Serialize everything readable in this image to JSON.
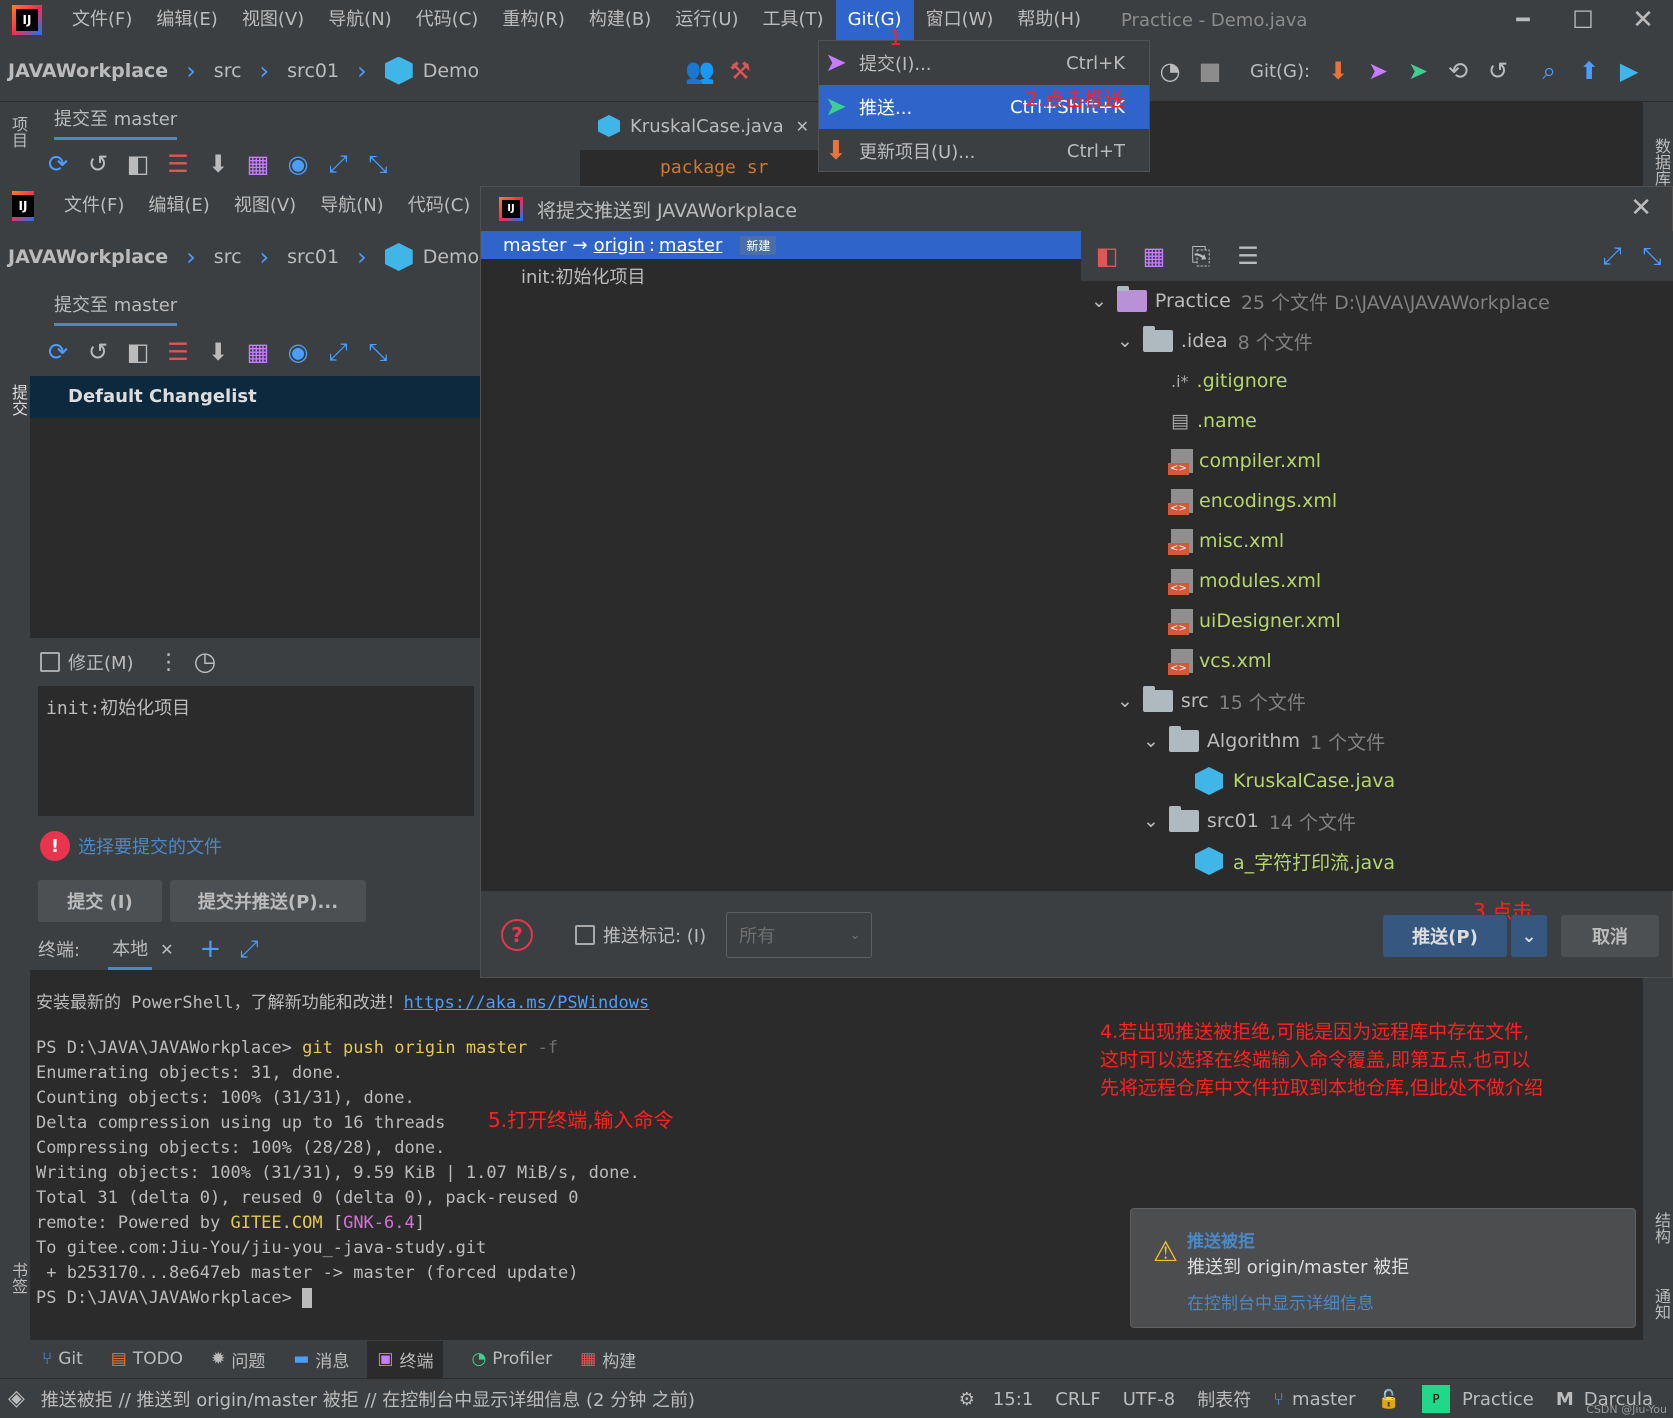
{
  "menubar": {
    "items": [
      "文件(F)",
      "编辑(E)",
      "视图(V)",
      "导航(N)",
      "代码(C)",
      "重构(R)",
      "构建(B)",
      "运行(U)",
      "工具(T)",
      "Git(G)",
      "窗口(W)",
      "帮助(H)"
    ],
    "title": "Practice - Demo.java"
  },
  "navbar": {
    "project": "JAVAWorkplace",
    "crumbs": [
      "src",
      "src01",
      "Demo"
    ],
    "git_label": "Git(G):"
  },
  "git_menu": {
    "items": [
      {
        "label": "提交(I)...",
        "shortcut": "Ctrl+K"
      },
      {
        "label": "推送...",
        "shortcut": "Ctrl+Shift+K"
      },
      {
        "label": "更新项目(U)...",
        "shortcut": "Ctrl+T"
      }
    ]
  },
  "annotations": {
    "a1": "1",
    "a2": "2.点击推送",
    "a3": "3.点击",
    "a4": [
      "4.若出现推送被拒绝,可能是因为远程库中存在文件,",
      "这时可以选择在终端输入命令覆盖,即第五点,也可以",
      "先将远程仓库中文件拉取到本地仓库,但此处不做介绍"
    ],
    "a5": "5.打开终端,输入命令"
  },
  "commit_panel": {
    "tab": "提交至 master",
    "changelist": "Default Changelist",
    "amend": "修正(M)",
    "message": "init:初始化项目",
    "warning": "选择要提交的文件",
    "commit_btn": "提交 (I)",
    "commit_push_btn": "提交并推送(P)..."
  },
  "side_tabs": {
    "project": "项目",
    "commit": "提交",
    "bookmarks": "书签",
    "database": "数据库",
    "structure": "结构",
    "notifications": "通知"
  },
  "editor": {
    "tab": "KruskalCase.java",
    "code_fragment": "package sr"
  },
  "push_dialog": {
    "title": "将提交推送到 JAVAWorkplace",
    "branch_src": "master",
    "arrow": "→",
    "remote": "origin",
    "colon": ":",
    "branch_dst": "master",
    "new_badge": "新建",
    "commit": "init:初始化项目",
    "push_tags": "推送标记: (I)",
    "tags_select": "所有",
    "push_btn": "推送(P)",
    "cancel_btn": "取消",
    "help": "?",
    "tree": [
      {
        "name": "Practice",
        "meta": "25 个文件  D:\\JAVA\\JAVAWorkplace"
      },
      {
        "name": ".idea",
        "meta": "8 个文件"
      },
      {
        "name": ".gitignore",
        "meta": ""
      },
      {
        "name": ".name",
        "meta": ""
      },
      {
        "name": "compiler.xml",
        "meta": ""
      },
      {
        "name": "encodings.xml",
        "meta": ""
      },
      {
        "name": "misc.xml",
        "meta": ""
      },
      {
        "name": "modules.xml",
        "meta": ""
      },
      {
        "name": "uiDesigner.xml",
        "meta": ""
      },
      {
        "name": "vcs.xml",
        "meta": ""
      },
      {
        "name": "src",
        "meta": "15 个文件"
      },
      {
        "name": "Algorithm",
        "meta": "1 个文件"
      },
      {
        "name": "KruskalCase.java",
        "meta": ""
      },
      {
        "name": "src01",
        "meta": "14 个文件"
      },
      {
        "name": "a_字符打印流.java",
        "meta": ""
      }
    ]
  },
  "terminal": {
    "label": "终端:",
    "tab": "本地",
    "intro": "安装最新的 PowerShell，了解新功能和改进！",
    "intro_link": "https://aka.ms/PSWindows",
    "prompt1": "PS D:\\JAVA\\JAVAWorkplace> ",
    "command": "git push origin master",
    "command_flag": " -f",
    "lines": [
      "Enumerating objects: 31, done.",
      "Counting objects: 100% (31/31), done.",
      "Delta compression using up to 16 threads",
      "Compressing objects: 100% (28/28), done.",
      "Writing objects: 100% (31/31), 9.59 KiB | 1.07 MiB/s, done.",
      "Total 31 (delta 0), reused 0 (delta 0), pack-reused 0"
    ],
    "remote_prefix": "remote: Powered by ",
    "remote_gitee": "GITEE.COM",
    "remote_open": " [",
    "remote_gnk": "GNK-6.4",
    "remote_close": "]",
    "to_line": "To gitee.com:Jiu-You/jiu-you_-java-study.git",
    "forced_line": " + b253170...8e647eb master -> master (forced update)",
    "prompt2": "PS D:\\JAVA\\JAVAWorkplace> "
  },
  "notification": {
    "title": "推送被拒",
    "body": "推送到 origin/master 被拒",
    "link": "在控制台中显示详细信息"
  },
  "bottom_tabs": [
    "Git",
    "TODO",
    "问题",
    "消息",
    "终端",
    "Profiler",
    "构建"
  ],
  "statusbar": {
    "message": "推送被拒 // 推送到 origin/master 被拒 // 在控制台中显示详细信息 (2 分钟 之前)",
    "position": "15:1",
    "line_sep": "CRLF",
    "encoding": "UTF-8",
    "indent": "制表符",
    "branch": "master",
    "project": "Practice",
    "theme": "Darcula",
    "watermark": "CSDN @Jiu-You"
  },
  "colors": {
    "accent": "#2f65ca",
    "annotation": "#ff2020",
    "bg": "#2b2b2b",
    "panel": "#3c3f41"
  }
}
